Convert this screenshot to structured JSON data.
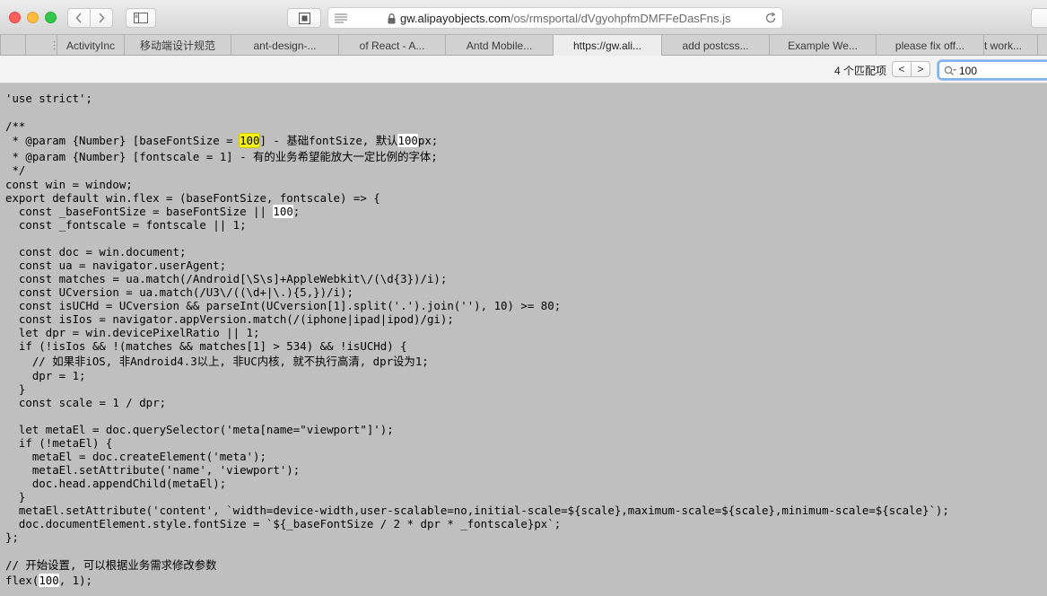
{
  "browser": {
    "url_host": "gw.alipayobjects.com",
    "url_path": "/os/rmsportal/dVgyohpfmDMFFeDasFns.js",
    "tabs": [
      {
        "label": "ActivityInc",
        "active": false
      },
      {
        "label": "移动端设计规范",
        "active": false
      },
      {
        "label": "ant-design-...",
        "active": false
      },
      {
        "label": "of React - A...",
        "active": false
      },
      {
        "label": "Antd Mobile...",
        "active": false
      },
      {
        "label": "https://gw.ali...",
        "active": true
      },
      {
        "label": "add postcss...",
        "active": false
      },
      {
        "label": "Example We...",
        "active": false
      },
      {
        "label": "please fix off...",
        "active": false
      },
      {
        "label": "t work...",
        "active": false
      }
    ]
  },
  "find": {
    "match_count": "4 个匹配项",
    "prev_label": "<",
    "next_label": ">",
    "query": "100"
  },
  "code": {
    "lines": [
      "'use strict';",
      "",
      "/**",
      " * @param {Number} [baseFontSize = 100] - 基础fontSize, 默认100px;",
      " * @param {Number} [fontscale = 1] - 有的业务希望能放大一定比例的字体;",
      " */",
      "const win = window;",
      "export default win.flex = (baseFontSize, fontscale) => {",
      "  const _baseFontSize = baseFontSize || 100;",
      "  const _fontscale = fontscale || 1;",
      "",
      "  const doc = win.document;",
      "  const ua = navigator.userAgent;",
      "  const matches = ua.match(/Android[\\S\\s]+AppleWebkit\\/(\\d{3})/i);",
      "  const UCversion = ua.match(/U3\\/((\\d+|\\.){5,})/i);",
      "  const isUCHd = UCversion && parseInt(UCversion[1].split('.').join(''), 10) >= 80;",
      "  const isIos = navigator.appVersion.match(/(iphone|ipad|ipod)/gi);",
      "  let dpr = win.devicePixelRatio || 1;",
      "  if (!isIos && !(matches && matches[1] > 534) && !isUCHd) {",
      "    // 如果非iOS, 非Android4.3以上, 非UC内核, 就不执行高清, dpr设为1;",
      "    dpr = 1;",
      "  }",
      "  const scale = 1 / dpr;",
      "",
      "  let metaEl = doc.querySelector('meta[name=\"viewport\"]');",
      "  if (!metaEl) {",
      "    metaEl = doc.createElement('meta');",
      "    metaEl.setAttribute('name', 'viewport');",
      "    doc.head.appendChild(metaEl);",
      "  }",
      "  metaEl.setAttribute('content', `width=device-width,user-scalable=no,initial-scale=${scale},maximum-scale=${scale},minimum-scale=${scale}`);",
      "  doc.documentElement.style.fontSize = `${_baseFontSize / 2 * dpr * _fontscale}px`;",
      "};",
      "",
      "// 开始设置, 可以根据业务需求修改参数",
      "flex(100, 1);"
    ]
  }
}
